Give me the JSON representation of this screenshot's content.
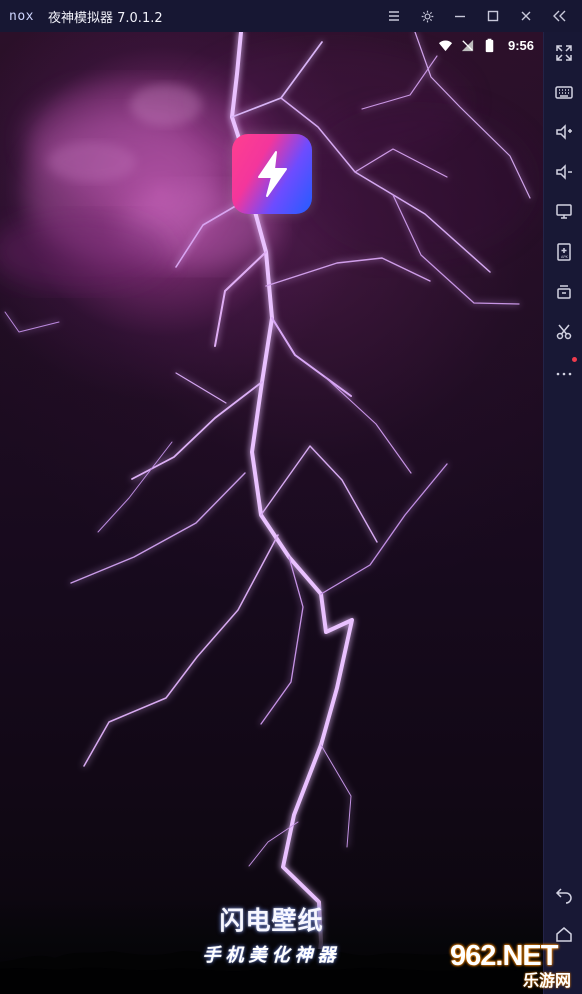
{
  "window": {
    "logo": "nox",
    "title": "夜神模拟器 7.0.1.2",
    "controls": {
      "menu_icon": "menu-icon",
      "settings_icon": "gear-icon",
      "minimize_icon": "minimize-icon",
      "maximize_icon": "maximize-icon",
      "close_icon": "close-icon",
      "collapse_icon": "double-chevron-left-icon"
    }
  },
  "statusbar": {
    "time": "9:56",
    "icons": [
      "wifi-icon",
      "signal-icon",
      "battery-icon"
    ]
  },
  "splash": {
    "app_icon": "lightning-bolt-icon",
    "title": "闪电壁纸",
    "subtitle": "手机美化神器"
  },
  "sidebar": {
    "items": [
      {
        "icon": "fullscreen-icon"
      },
      {
        "icon": "keyboard-icon"
      },
      {
        "icon": "volume-up-icon"
      },
      {
        "icon": "volume-down-icon"
      },
      {
        "icon": "screen-icon"
      },
      {
        "icon": "apk-install-icon"
      },
      {
        "icon": "multi-instance-icon"
      },
      {
        "icon": "scissors-icon"
      },
      {
        "icon": "more-icon",
        "badge": true
      },
      {
        "icon": "back-icon"
      },
      {
        "icon": "home-icon"
      }
    ]
  },
  "watermark": {
    "main": "962.NET",
    "sub": "乐游网"
  },
  "colors": {
    "titlebar": "#171733",
    "sidebar": "#181835",
    "sky_dark": "#110815",
    "lightning": "#f4d9ff",
    "lightning_glow": "#d279ff",
    "badge_red": "#ef3b4d"
  }
}
